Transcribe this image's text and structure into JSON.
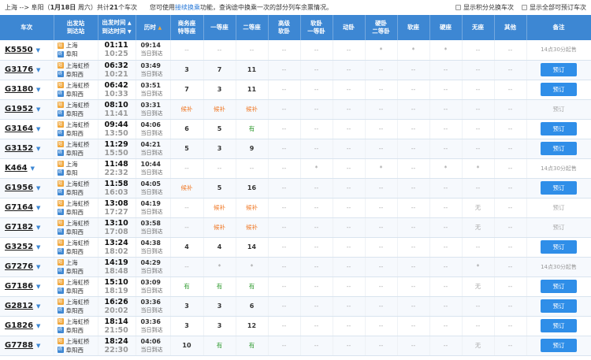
{
  "topbar": {
    "from": "上海",
    "arrow": "-->",
    "to": "阜阳",
    "date_pre": "（",
    "date": "1月18日",
    "weekday": " 周六）共计",
    "count": "21",
    "count_suffix": "个车次",
    "tip_pre": "您可使用",
    "tip_link": "接续换乘",
    "tip_post": "功能，查询途中换乘一次的部分列车余票情况。",
    "opt1": "显示积分兑换车次",
    "opt2": "显示全部可预订车次"
  },
  "headers": {
    "train": "车次",
    "station_a": "出发站",
    "station_b": "到达站",
    "time_a": "出发时间",
    "time_b": "到达时间",
    "duration": "历时",
    "business_a": "商务座",
    "business_b": "特等座",
    "first": "一等座",
    "second": "二等座",
    "advsoft_a": "高级",
    "advsoft_b": "软卧",
    "soft_a": "软卧",
    "soft_b": "一等卧",
    "dongwo": "动卧",
    "hard_a": "硬卧",
    "hard_b": "二等卧",
    "softseat": "软座",
    "hardseat": "硬座",
    "noseat": "无座",
    "other": "其他",
    "remark": "备注"
  },
  "rows": [
    {
      "no": "K5550",
      "from": "上海",
      "to": "阜阳",
      "fb": "始",
      "tb": "终",
      "dep": "01:11",
      "arr": "10:25",
      "dur": "09:14",
      "day": "当日到达",
      "c": [
        "--",
        "--",
        "--",
        "--",
        "--",
        "--",
        "*",
        "*",
        "*",
        "--",
        "--"
      ],
      "remark": "14点30分起售",
      "btn": false
    },
    {
      "no": "G3176",
      "from": "上海虹桥",
      "to": "阜阳西",
      "fb": "始",
      "tb": "终",
      "dep": "06:32",
      "arr": "10:21",
      "dur": "03:49",
      "day": "当日到达",
      "c": [
        "3",
        "7",
        "11",
        "--",
        "--",
        "--",
        "--",
        "--",
        "--",
        "--",
        "--"
      ],
      "remark": "预订",
      "btn": true
    },
    {
      "no": "G3180",
      "from": "上海虹桥",
      "to": "阜阳西",
      "fb": "始",
      "tb": "终",
      "dep": "06:42",
      "arr": "10:33",
      "dur": "03:51",
      "day": "当日到达",
      "c": [
        "7",
        "3",
        "11",
        "--",
        "--",
        "--",
        "--",
        "--",
        "--",
        "--",
        "--"
      ],
      "remark": "预订",
      "btn": true
    },
    {
      "no": "G1952",
      "from": "上海虹桥",
      "to": "阜阳西",
      "fb": "始",
      "tb": "终",
      "dep": "08:10",
      "arr": "11:41",
      "dur": "03:31",
      "day": "当日到达",
      "c": [
        "候补",
        "候补",
        "候补",
        "--",
        "--",
        "--",
        "--",
        "--",
        "--",
        "--",
        "--"
      ],
      "remark": "预订",
      "btn": false
    },
    {
      "no": "G3164",
      "from": "上海虹桥",
      "to": "阜阳西",
      "fb": "始",
      "tb": "终",
      "dep": "09:44",
      "arr": "13:50",
      "dur": "04:06",
      "day": "当日到达",
      "c": [
        "6",
        "5",
        "有",
        "--",
        "--",
        "--",
        "--",
        "--",
        "--",
        "--",
        "--"
      ],
      "remark": "预订",
      "btn": true
    },
    {
      "no": "G3152",
      "from": "上海虹桥",
      "to": "阜阳西",
      "fb": "始",
      "tb": "终",
      "dep": "11:29",
      "arr": "15:50",
      "dur": "04:21",
      "day": "当日到达",
      "c": [
        "5",
        "3",
        "9",
        "--",
        "--",
        "--",
        "--",
        "--",
        "--",
        "--",
        "--"
      ],
      "remark": "预订",
      "btn": true
    },
    {
      "no": "K464",
      "from": "上海",
      "to": "阜阳",
      "fb": "始",
      "tb": "终",
      "dep": "11:48",
      "arr": "22:32",
      "dur": "10:44",
      "day": "当日到达",
      "c": [
        "--",
        "--",
        "--",
        "--",
        "*",
        "--",
        "*",
        "--",
        "*",
        "*",
        "--"
      ],
      "remark": "14点30分起售",
      "btn": false
    },
    {
      "no": "G1956",
      "from": "上海虹桥",
      "to": "阜阳西",
      "fb": "始",
      "tb": "终",
      "dep": "11:58",
      "arr": "16:03",
      "dur": "04:05",
      "day": "当日到达",
      "c": [
        "候补",
        "5",
        "16",
        "--",
        "--",
        "--",
        "--",
        "--",
        "--",
        "--",
        "--"
      ],
      "remark": "预订",
      "btn": true
    },
    {
      "no": "G7164",
      "from": "上海虹桥",
      "to": "阜阳西",
      "fb": "始",
      "tb": "终",
      "dep": "13:08",
      "arr": "17:27",
      "dur": "04:19",
      "day": "当日到达",
      "c": [
        "--",
        "候补",
        "候补",
        "--",
        "--",
        "--",
        "--",
        "--",
        "--",
        "无",
        "--"
      ],
      "remark": "预订",
      "btn": false
    },
    {
      "no": "G7182",
      "from": "上海虹桥",
      "to": "阜阳西",
      "fb": "始",
      "tb": "终",
      "dep": "13:10",
      "arr": "17:08",
      "dur": "03:58",
      "day": "当日到达",
      "c": [
        "--",
        "候补",
        "候补",
        "--",
        "--",
        "--",
        "--",
        "--",
        "--",
        "无",
        "--"
      ],
      "remark": "预订",
      "btn": false
    },
    {
      "no": "G3252",
      "from": "上海虹桥",
      "to": "阜阳西",
      "fb": "始",
      "tb": "终",
      "dep": "13:24",
      "arr": "18:02",
      "dur": "04:38",
      "day": "当日到达",
      "c": [
        "4",
        "4",
        "14",
        "--",
        "--",
        "--",
        "--",
        "--",
        "--",
        "--",
        "--"
      ],
      "remark": "预订",
      "btn": true
    },
    {
      "no": "G7276",
      "from": "上海",
      "to": "阜阳西",
      "fb": "始",
      "tb": "终",
      "dep": "14:19",
      "arr": "18:48",
      "dur": "04:29",
      "day": "当日到达",
      "c": [
        "--",
        "*",
        "*",
        "--",
        "--",
        "--",
        "--",
        "--",
        "--",
        "*",
        "--"
      ],
      "remark": "14点30分起售",
      "btn": false
    },
    {
      "no": "G7186",
      "from": "上海虹桥",
      "to": "阜阳西",
      "fb": "始",
      "tb": "终",
      "dep": "15:10",
      "arr": "18:19",
      "dur": "03:09",
      "day": "当日到达",
      "c": [
        "有",
        "有",
        "有",
        "--",
        "--",
        "--",
        "--",
        "--",
        "--",
        "无",
        "--"
      ],
      "remark": "预订",
      "btn": true
    },
    {
      "no": "G2812",
      "from": "上海虹桥",
      "to": "阜阳西",
      "fb": "始",
      "tb": "终",
      "dep": "16:26",
      "arr": "20:02",
      "dur": "03:36",
      "day": "当日到达",
      "c": [
        "3",
        "3",
        "6",
        "--",
        "--",
        "--",
        "--",
        "--",
        "--",
        "--",
        "--"
      ],
      "remark": "预订",
      "btn": true
    },
    {
      "no": "G1826",
      "from": "上海虹桥",
      "to": "阜阳西",
      "fb": "始",
      "tb": "终",
      "dep": "18:14",
      "arr": "21:50",
      "dur": "03:36",
      "day": "当日到达",
      "c": [
        "3",
        "3",
        "12",
        "--",
        "--",
        "--",
        "--",
        "--",
        "--",
        "--",
        "--"
      ],
      "remark": "预订",
      "btn": true
    },
    {
      "no": "G7788",
      "from": "上海虹桥",
      "to": "阜阳西",
      "fb": "始",
      "tb": "终",
      "dep": "18:24",
      "arr": "22:30",
      "dur": "04:06",
      "day": "当日到达",
      "c": [
        "10",
        "有",
        "有",
        "--",
        "--",
        "--",
        "--",
        "--",
        "--",
        "无",
        "--"
      ],
      "remark": "预订",
      "btn": true
    }
  ],
  "colors": {
    "header": "#3d87d3",
    "button": "#2f8ee8",
    "available": "#2e9a2e",
    "waitlist": "#f07b2a"
  }
}
